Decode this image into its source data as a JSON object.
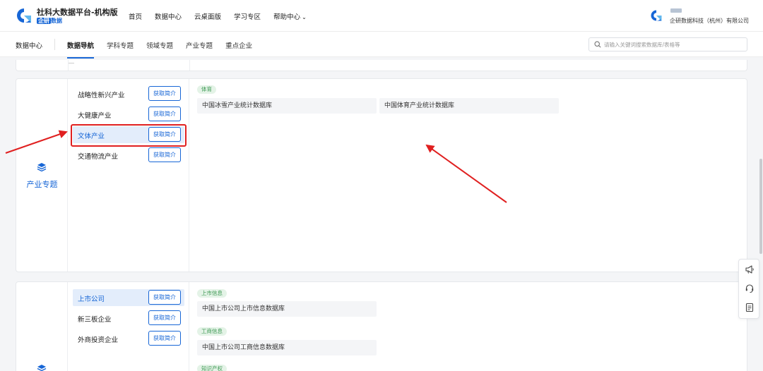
{
  "header": {
    "brand_title": "社科大数据平台-机构版",
    "brand_tag": "企研",
    "brand_tag_suffix": "数据",
    "nav": [
      "首页",
      "数据中心",
      "云桌面版",
      "学习专区",
      "帮助中心"
    ],
    "user_company": "企研数据科技（杭州）有限公司"
  },
  "subnav": {
    "home": "数据中心",
    "tabs": [
      "数据导航",
      "学科专题",
      "领域专题",
      "产业专题",
      "重点企业"
    ],
    "active_tab": "数据导航",
    "search_placeholder": "请输入关键词搜索数据库/表格等"
  },
  "intro_button_label": "获取简介",
  "industry_card": {
    "category": "产业专题",
    "icon": "layers-icon",
    "subcategories": [
      "战略性新兴产业",
      "大健康产业",
      "文体产业",
      "交通物流产业"
    ],
    "selected": "文体产业",
    "group_tag": "体育",
    "databases": [
      "中国冰雪产业统计数据库",
      "中国体育产业统计数据库"
    ]
  },
  "company_card": {
    "icon": "layers-icon",
    "subcategories": [
      "上市公司",
      "新三板企业",
      "外商投资企业"
    ],
    "selected": "上市公司",
    "groups": [
      {
        "tag": "上市信息",
        "databases": [
          "中国上市公司上市信息数据库"
        ]
      },
      {
        "tag": "工商信息",
        "databases": [
          "中国上市公司工商信息数据库"
        ]
      },
      {
        "tag": "知识产权",
        "databases": []
      }
    ]
  },
  "float_tools": [
    "megaphone-icon",
    "headset-icon",
    "document-icon"
  ],
  "colors": {
    "accent": "#1766d6",
    "highlight": "#e02020",
    "tag_bg": "#e4f3e7",
    "tag_text": "#3f9a55"
  }
}
